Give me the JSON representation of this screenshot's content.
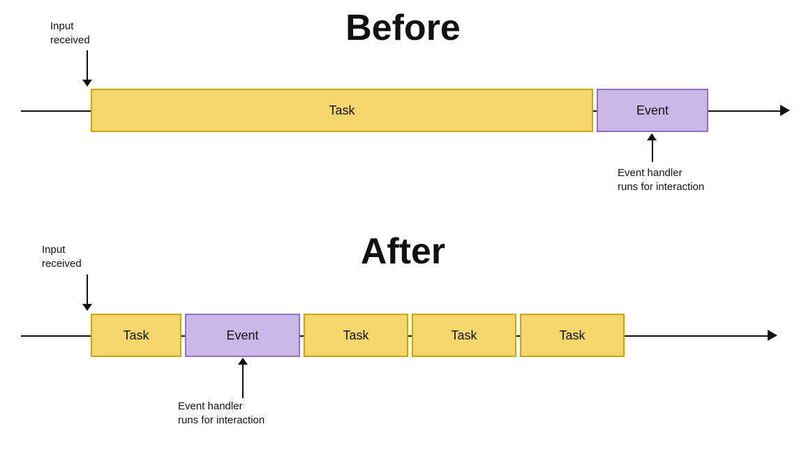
{
  "before": {
    "title": "Before",
    "input_label": "Input\nreceived",
    "task_label": "Task",
    "event_label": "Event",
    "handler_label": "Event handler\nruns for interaction"
  },
  "after": {
    "title": "After",
    "input_label": "Input\nreceived",
    "task1_label": "Task",
    "event_label": "Event",
    "task2_label": "Task",
    "task3_label": "Task",
    "task4_label": "Task",
    "handler_label": "Event handler\nruns for interaction"
  }
}
